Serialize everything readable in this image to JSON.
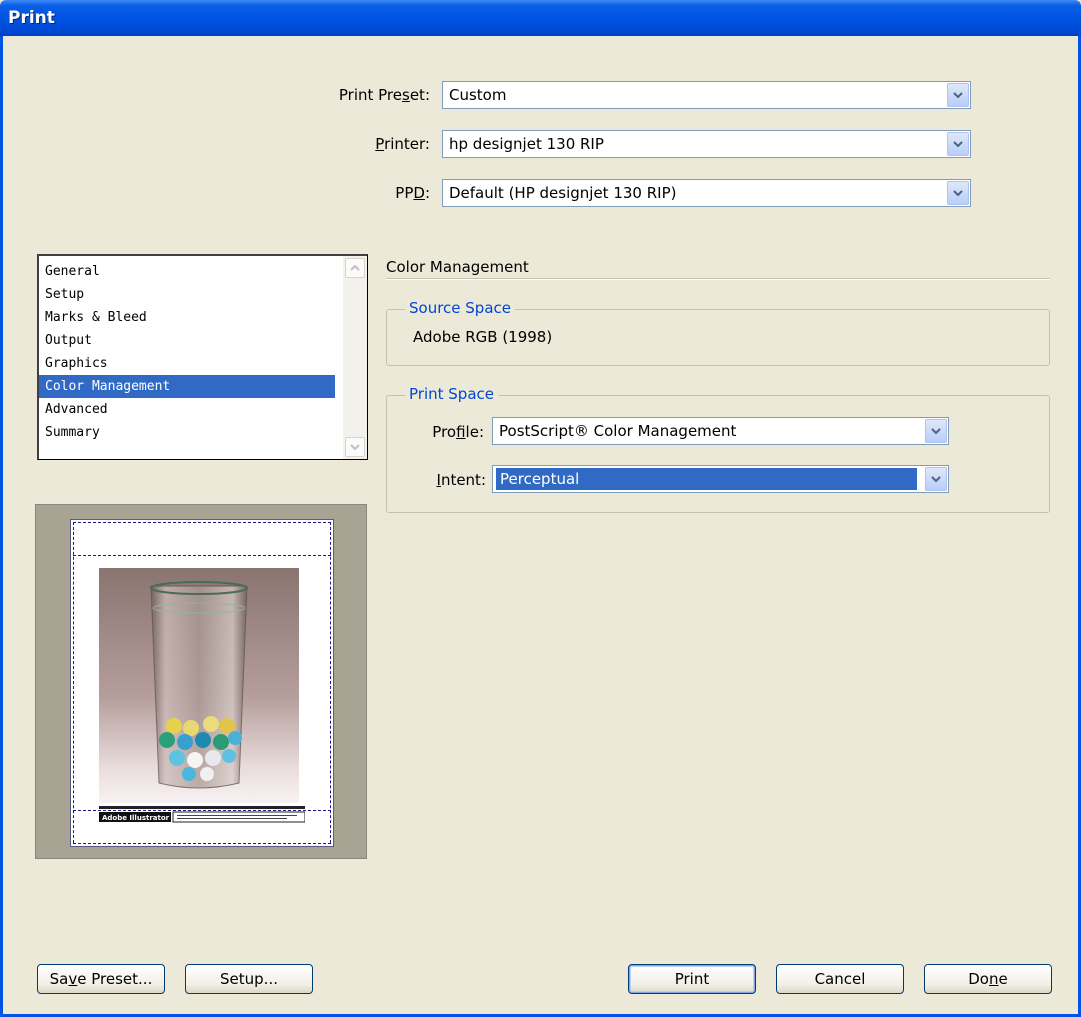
{
  "window": {
    "title": "Print"
  },
  "top_fields": {
    "preset": {
      "label_pre": "Print Pre",
      "label_ul": "s",
      "label_post": "et:",
      "value": "Custom"
    },
    "printer": {
      "label_pre": "",
      "label_ul": "P",
      "label_post": "rinter:",
      "value": "hp designjet 130 RIP"
    },
    "ppd": {
      "label_pre": "PP",
      "label_ul": "D",
      "label_post": ":",
      "value": "Default (HP designjet 130 RIP)"
    }
  },
  "sidebar": {
    "items": [
      {
        "label": "General"
      },
      {
        "label": "Setup"
      },
      {
        "label": "Marks & Bleed"
      },
      {
        "label": "Output"
      },
      {
        "label": "Graphics"
      },
      {
        "label": "Color Management"
      },
      {
        "label": "Advanced"
      },
      {
        "label": "Summary"
      }
    ],
    "selected": "Color Management"
  },
  "panel": {
    "title": "Color Management",
    "source_space": {
      "legend": "Source Space",
      "value": "Adobe RGB (1998)"
    },
    "print_space": {
      "legend": "Print Space",
      "profile": {
        "label_pre": "Pro",
        "label_ul": "f",
        "label_post": "ile:",
        "value": "PostScript® Color Management"
      },
      "intent": {
        "label_pre": "",
        "label_ul": "I",
        "label_post": "ntent:",
        "value": "Perceptual"
      }
    }
  },
  "buttons": {
    "save_preset": {
      "pre": "Sa",
      "ul": "v",
      "post": "e Preset..."
    },
    "setup": {
      "label": "Setup..."
    },
    "print": {
      "label": "Print"
    },
    "cancel": {
      "label": "Cancel"
    },
    "done": {
      "pre": "Do",
      "ul": "n",
      "post": "e"
    }
  },
  "preview": {
    "footer_label": "Adobe Illustrator"
  },
  "colors": {
    "selection": "#316ac5",
    "dialog_bg": "#ece9d8",
    "legend_blue": "#0046d5",
    "titlebar_blue": "#0054e3"
  }
}
